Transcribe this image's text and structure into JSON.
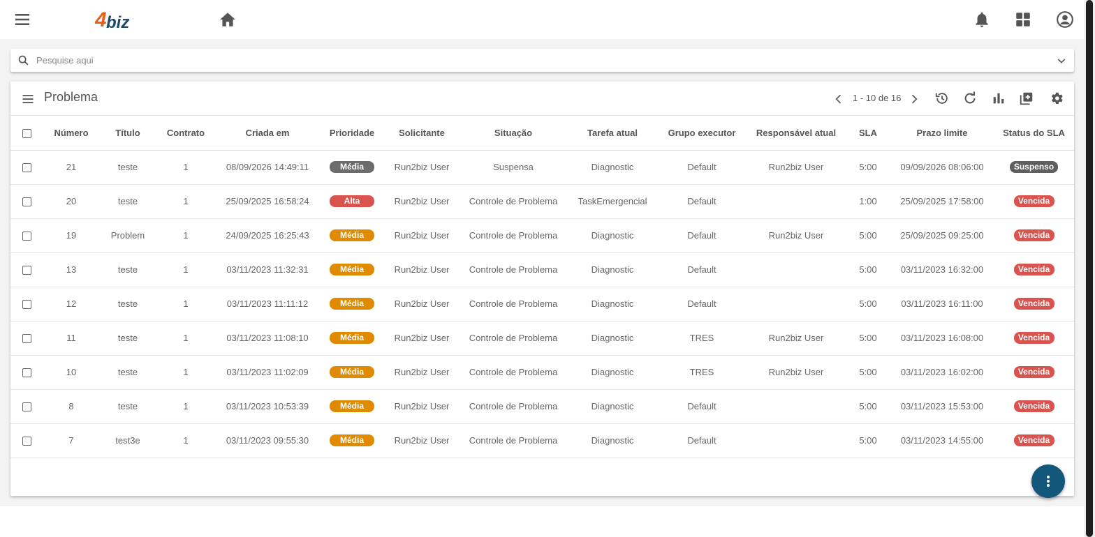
{
  "app": {
    "logo_text": "4biz"
  },
  "search": {
    "placeholder": "Pesquise aqui"
  },
  "panel": {
    "title": "Problema",
    "pagination": "1 - 10 de 16"
  },
  "table": {
    "headers": [
      "Número",
      "Título",
      "Contrato",
      "Criada em",
      "Prioridade",
      "Solicitante",
      "Situação",
      "Tarefa atual",
      "Grupo executor",
      "Responsável atual",
      "SLA",
      "Prazo limite",
      "Status do SLA"
    ],
    "rows": [
      {
        "numero": "21",
        "titulo": "teste",
        "contrato": "1",
        "criada": "08/09/2026 14:49:11",
        "prioridade": "Média",
        "prioridade_color": "#6c6c6c",
        "solicitante": "Run2biz User",
        "situacao": "Suspensa",
        "tarefa": "Diagnostic",
        "grupo": "Default",
        "responsavel": "Run2biz User",
        "sla": "5:00",
        "prazo": "09/09/2026 08:06:00",
        "status_sla": "Suspenso",
        "status_color": "#5f5f5f"
      },
      {
        "numero": "20",
        "titulo": "teste",
        "contrato": "1",
        "criada": "25/09/2025 16:58:24",
        "prioridade": "Alta",
        "prioridade_color": "#d9534f",
        "solicitante": "Run2biz User",
        "situacao": "Controle de Problema",
        "tarefa": "TaskEmergencial",
        "grupo": "Default",
        "responsavel": "",
        "sla": "1:00",
        "prazo": "25/09/2025 17:58:00",
        "status_sla": "Vencida",
        "status_color": "#d9534f"
      },
      {
        "numero": "19",
        "titulo": "Problem",
        "contrato": "1",
        "criada": "24/09/2025 16:25:43",
        "prioridade": "Média",
        "prioridade_color": "#e08a00",
        "solicitante": "Run2biz User",
        "situacao": "Controle de Problema",
        "tarefa": "Diagnostic",
        "grupo": "Default",
        "responsavel": "Run2biz User",
        "sla": "5:00",
        "prazo": "25/09/2025 09:25:00",
        "status_sla": "Vencida",
        "status_color": "#d9534f"
      },
      {
        "numero": "13",
        "titulo": "teste",
        "contrato": "1",
        "criada": "03/11/2023 11:32:31",
        "prioridade": "Média",
        "prioridade_color": "#e08a00",
        "solicitante": "Run2biz User",
        "situacao": "Controle de Problema",
        "tarefa": "Diagnostic",
        "grupo": "Default",
        "responsavel": "",
        "sla": "5:00",
        "prazo": "03/11/2023 16:32:00",
        "status_sla": "Vencida",
        "status_color": "#d9534f"
      },
      {
        "numero": "12",
        "titulo": "teste",
        "contrato": "1",
        "criada": "03/11/2023 11:11:12",
        "prioridade": "Média",
        "prioridade_color": "#e08a00",
        "solicitante": "Run2biz User",
        "situacao": "Controle de Problema",
        "tarefa": "Diagnostic",
        "grupo": "Default",
        "responsavel": "",
        "sla": "5:00",
        "prazo": "03/11/2023 16:11:00",
        "status_sla": "Vencida",
        "status_color": "#d9534f"
      },
      {
        "numero": "11",
        "titulo": "teste",
        "contrato": "1",
        "criada": "03/11/2023 11:08:10",
        "prioridade": "Média",
        "prioridade_color": "#e08a00",
        "solicitante": "Run2biz User",
        "situacao": "Controle de Problema",
        "tarefa": "Diagnostic",
        "grupo": "TRES",
        "responsavel": "Run2biz User",
        "sla": "5:00",
        "prazo": "03/11/2023 16:08:00",
        "status_sla": "Vencida",
        "status_color": "#d9534f"
      },
      {
        "numero": "10",
        "titulo": "teste",
        "contrato": "1",
        "criada": "03/11/2023 11:02:09",
        "prioridade": "Média",
        "prioridade_color": "#e08a00",
        "solicitante": "Run2biz User",
        "situacao": "Controle de Problema",
        "tarefa": "Diagnostic",
        "grupo": "TRES",
        "responsavel": "Run2biz User",
        "sla": "5:00",
        "prazo": "03/11/2023 16:02:00",
        "status_sla": "Vencida",
        "status_color": "#d9534f"
      },
      {
        "numero": "8",
        "titulo": "teste",
        "contrato": "1",
        "criada": "03/11/2023 10:53:39",
        "prioridade": "Média",
        "prioridade_color": "#e08a00",
        "solicitante": "Run2biz User",
        "situacao": "Controle de Problema",
        "tarefa": "Diagnostic",
        "grupo": "Default",
        "responsavel": "",
        "sla": "5:00",
        "prazo": "03/11/2023 15:53:00",
        "status_sla": "Vencida",
        "status_color": "#d9534f"
      },
      {
        "numero": "7",
        "titulo": "test3e",
        "contrato": "1",
        "criada": "03/11/2023 09:55:30",
        "prioridade": "Média",
        "prioridade_color": "#e08a00",
        "solicitante": "Run2biz User",
        "situacao": "Controle de Problema",
        "tarefa": "Diagnostic",
        "grupo": "Default",
        "responsavel": "",
        "sla": "5:00",
        "prazo": "03/11/2023 14:55:00",
        "status_sla": "Vencida",
        "status_color": "#d9534f"
      }
    ]
  },
  "icons": {
    "menu": "hamburger-menu-icon",
    "home": "home-icon",
    "notifications": "bell-icon",
    "apps": "grid-apps-icon",
    "account": "account-circle-icon",
    "search": "search-icon",
    "expand": "chevron-down-icon",
    "list": "list-menu-icon",
    "prev": "chevron-left-icon",
    "next": "chevron-right-icon",
    "history": "history-icon",
    "refresh": "refresh-icon",
    "chart": "bar-chart-icon",
    "add": "add-box-icon",
    "settings": "gear-icon",
    "more": "more-vertical-icon"
  },
  "colors": {
    "brand_orange": "#e8611d",
    "brand_blue": "#1b4a6b",
    "fab": "#13587b",
    "priority_medium": "#e08a00",
    "priority_high": "#d9534f",
    "sla_overdue": "#d9534f",
    "sla_suspended": "#5f5f5f"
  }
}
